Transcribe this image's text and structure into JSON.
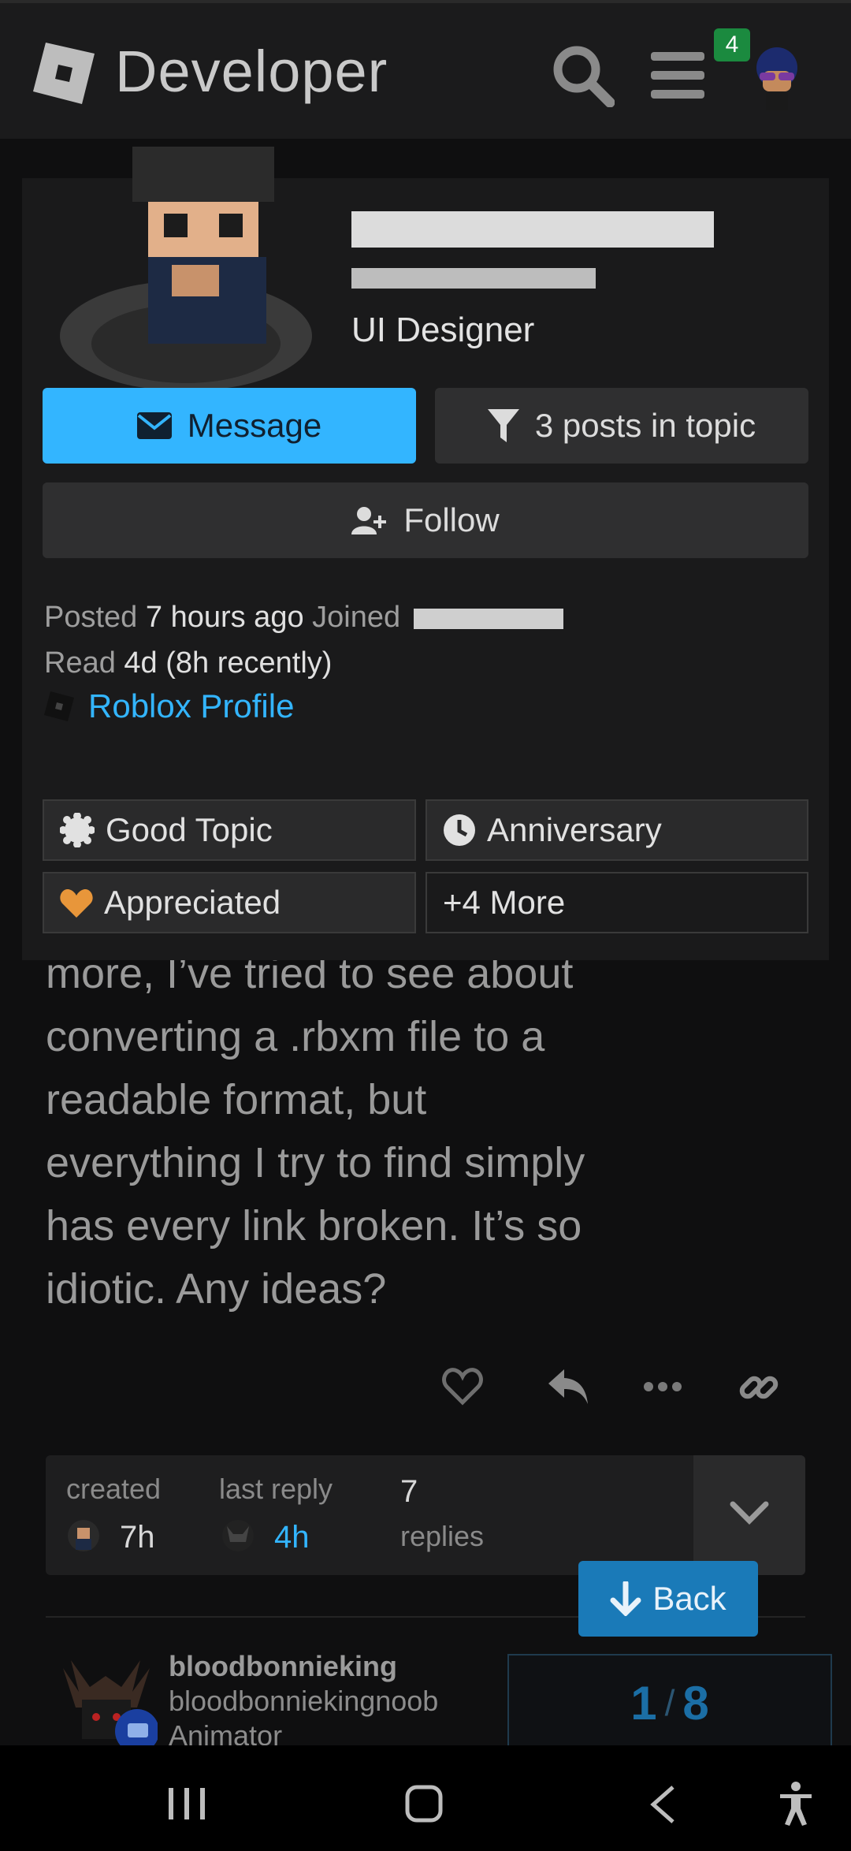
{
  "header": {
    "brand": "Developer",
    "notification_count": "4"
  },
  "post": {
    "lines": [
      "more, I’ve tried to see about",
      "converting a .rbxm file to a",
      "readable format, but",
      "everything I try to find simply",
      "has every link broken. It’s so",
      "idiotic. Any ideas?"
    ]
  },
  "user_card": {
    "title": "UI Designer",
    "message_label": "Message",
    "posts_label": "3 posts in topic",
    "follow_label": "Follow",
    "posted_label": "Posted",
    "posted_value": "7 hours ago",
    "joined_label": "Joined",
    "read_label": "Read",
    "read_value": "4d (8h recently)",
    "profile_link": "Roblox Profile",
    "badges": [
      "Good Topic",
      "Anniversary",
      "Appreciated",
      "+4 More"
    ]
  },
  "topic_stats": {
    "created_label": "created",
    "created_value": "7h",
    "last_reply_label": "last reply",
    "last_reply_value": "4h",
    "replies_count": "7",
    "replies_label": "replies"
  },
  "back_label": "Back",
  "next_post": {
    "username": "bloodbonnieking",
    "handle": "bloodbonniekingnoob",
    "title": "Animator"
  },
  "timeline": {
    "current": "1",
    "separator": "/",
    "total": "8"
  },
  "colors": {
    "accent": "#33b5ff",
    "background": "#0f0f10",
    "card": "#1a1a1b",
    "badge_green": "#1b8a3f",
    "heart_orange": "#e8963a"
  }
}
